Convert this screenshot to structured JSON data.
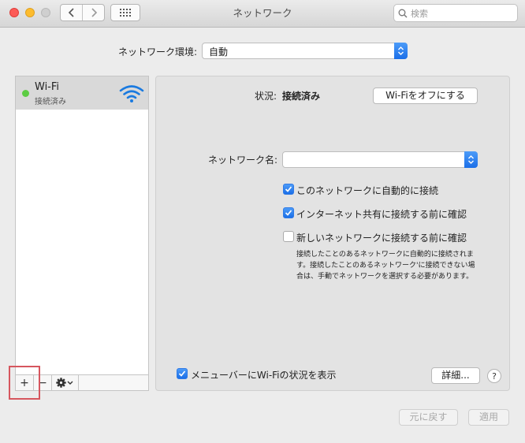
{
  "window": {
    "title": "ネットワーク"
  },
  "search": {
    "placeholder": "検索"
  },
  "location": {
    "label": "ネットワーク環境:",
    "value": "自動"
  },
  "services": [
    {
      "name": "Wi-Fi",
      "status": "接続済み"
    }
  ],
  "status": {
    "label": "状況:",
    "value": "接続済み",
    "toggle_button": "Wi-Fiをオフにする"
  },
  "network_name": {
    "label": "ネットワーク名:",
    "value": ""
  },
  "options": [
    {
      "label": "このネットワークに自動的に接続",
      "checked": true
    },
    {
      "label": "インターネット共有に接続する前に確認",
      "checked": true
    },
    {
      "label": "新しいネットワークに接続する前に確認",
      "checked": false
    }
  ],
  "description": "接続したことのあるネットワークに自動的に接続されます。接続したことのあるネットワーク'に接続できない場合は、手動でネットワークを選択する必要があります。",
  "menubar_option": {
    "label": "メニューバーにWi-Fiの状況を表示",
    "checked": true
  },
  "buttons": {
    "advanced": "詳細...",
    "help": "?",
    "revert": "元に戻す",
    "apply": "適用"
  },
  "toolbar": {
    "add": "+",
    "remove": "−"
  },
  "colors": {
    "accent": "#1b6fe8",
    "connected": "#5ccc43",
    "highlight": "#d6565e"
  }
}
